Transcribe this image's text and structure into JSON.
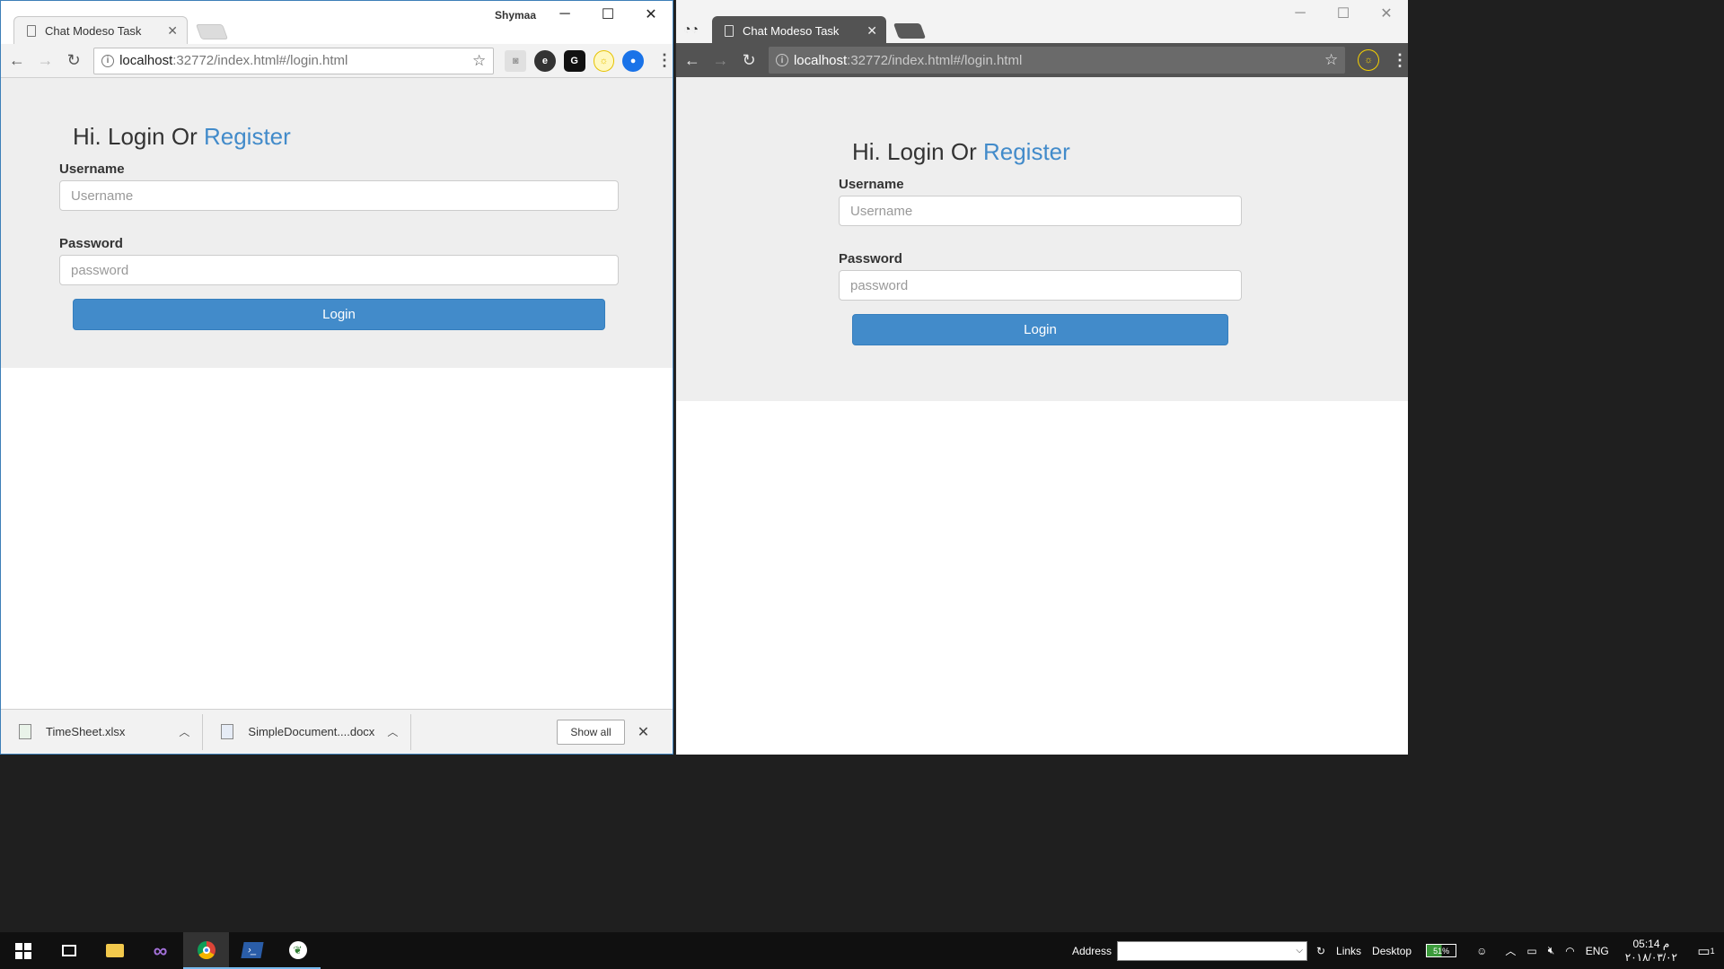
{
  "left_window": {
    "profile_name": "Shymaa",
    "tab_title": "Chat Modeso Task",
    "url_host": "localhost",
    "url_rest": ":32772/index.html#/login.html",
    "form": {
      "heading_prefix": "Hi. Login Or",
      "heading_link": "Register",
      "username_label": "Username",
      "username_placeholder": "Username",
      "password_label": "Password",
      "password_placeholder": "password",
      "login_button": "Login"
    },
    "downloads": [
      {
        "name": "TimeSheet.xlsx"
      },
      {
        "name": "SimpleDocument....docx"
      }
    ],
    "show_all": "Show all"
  },
  "right_window": {
    "tab_title": "Chat Modeso Task",
    "url_host": "localhost",
    "url_rest": ":32772/index.html#/login.html",
    "form": {
      "heading_prefix": "Hi. Login Or",
      "heading_link": "Register",
      "username_label": "Username",
      "username_placeholder": "Username",
      "password_label": "Password",
      "password_placeholder": "password",
      "login_button": "Login"
    }
  },
  "taskbar": {
    "address_label": "Address",
    "links_label": "Links",
    "desktop_label": "Desktop",
    "battery_percent": "51%",
    "language": "ENG",
    "time": "05:14 م",
    "date": "٢٠١٨/٠٣/٠٢",
    "notification_count": "1"
  },
  "colors": {
    "accent": "#428bca",
    "jumbotron": "#eeeeee",
    "taskbar": "#101010"
  }
}
